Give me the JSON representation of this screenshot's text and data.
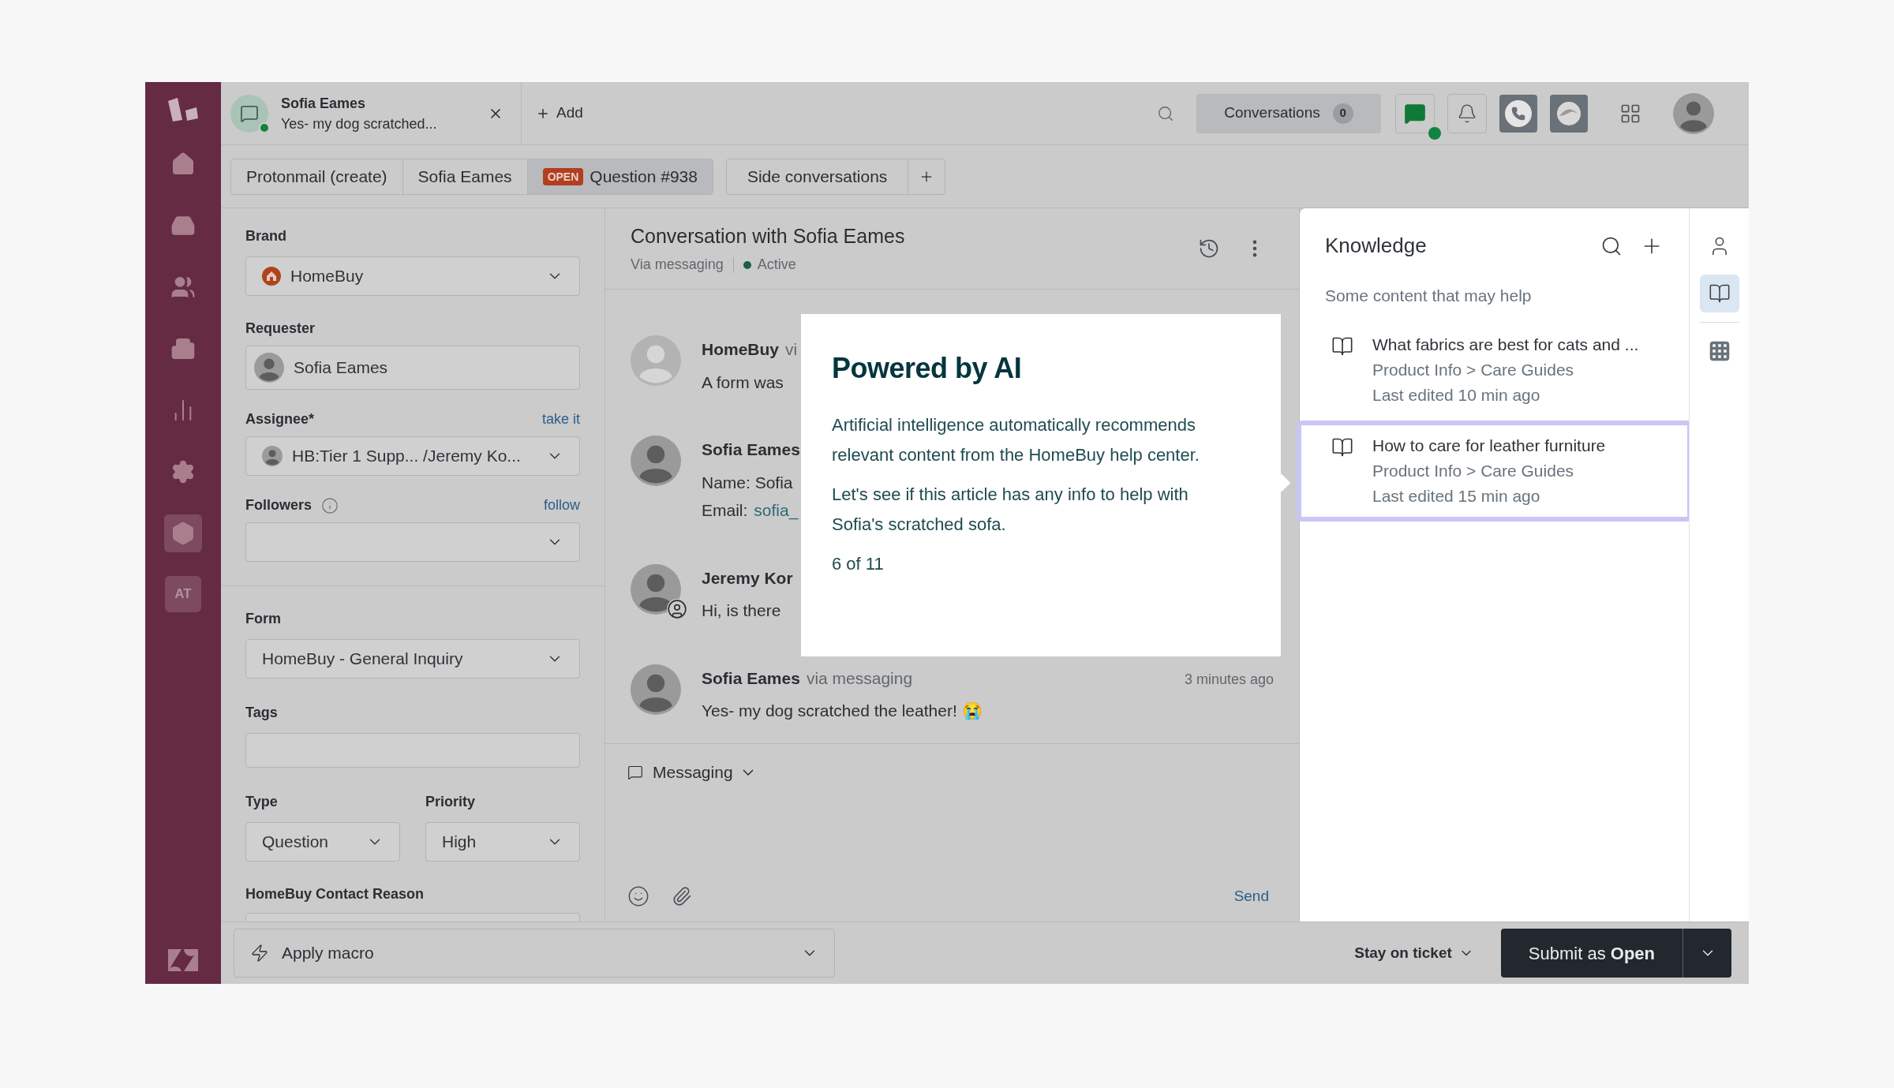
{
  "nav": {
    "items": [
      {
        "kind": "home",
        "selected": false
      },
      {
        "kind": "views",
        "selected": false
      },
      {
        "kind": "customers",
        "selected": false
      },
      {
        "kind": "organizations",
        "selected": false
      },
      {
        "kind": "reporting",
        "selected": false
      },
      {
        "kind": "admin",
        "selected": false
      },
      {
        "kind": "apps",
        "selected": true
      },
      {
        "kind": "initials",
        "label": "AT",
        "selected": false
      }
    ]
  },
  "ticket_tab": {
    "title": "Sofia Eames",
    "preview": "Yes- my dog scratched...",
    "online": true
  },
  "add_tab": {
    "label": "Add"
  },
  "conversations": {
    "label": "Conversations",
    "count": "0"
  },
  "chat_status": {
    "online": true
  },
  "subtabs": [
    {
      "label": "Protonmail (create)",
      "selected": false
    },
    {
      "label": "Sofia Eames",
      "selected": false
    },
    {
      "label": "Question #938",
      "badge": "OPEN",
      "selected": true
    }
  ],
  "side_conversations": {
    "label": "Side conversations"
  },
  "fields": {
    "brand": {
      "label": "Brand",
      "value": "HomeBuy"
    },
    "requester": {
      "label": "Requester",
      "value": "Sofia Eames"
    },
    "assignee": {
      "label": "Assignee*",
      "link": "take it",
      "value": "HB:Tier 1 Supp... /Jeremy Ko..."
    },
    "followers": {
      "label": "Followers",
      "link": "follow"
    },
    "form": {
      "label": "Form",
      "value": "HomeBuy - General Inquiry"
    },
    "tags": {
      "label": "Tags"
    },
    "type": {
      "label": "Type",
      "value": "Question"
    },
    "priority": {
      "label": "Priority",
      "value": "High"
    },
    "contact_reason": {
      "label": "HomeBuy Contact Reason"
    }
  },
  "conversation": {
    "title": "Conversation with Sofia Eames",
    "channel": "Via messaging",
    "status": "Active",
    "messages": [
      {
        "kind": "bot",
        "author": "HomeBuy",
        "via": "vi",
        "body": "A form was"
      },
      {
        "kind": "customer",
        "author": "Sofia Eames",
        "body": "Name: Sofia",
        "email_label": "Email:",
        "email": "sofia_"
      },
      {
        "kind": "agent",
        "author": "Jeremy Kor",
        "body": "Hi, is there"
      },
      {
        "kind": "customer",
        "author": "Sofia Eames",
        "via": "via messaging",
        "time": "3 minutes ago",
        "body": "Yes- my dog scratched the leather! 😭"
      }
    ]
  },
  "composer": {
    "channel": "Messaging",
    "send": "Send"
  },
  "tour": {
    "title": "Powered by AI",
    "paragraphs": [
      "Artificial intelligence automatically recommends relevant content from the HomeBuy help center.",
      "Let's see if this article has any info to help with Sofia's scratched sofa."
    ],
    "step": "6 of 11"
  },
  "knowledge": {
    "title": "Knowledge",
    "subtitle": "Some content that may help",
    "articles": [
      {
        "title": "What fabrics are best for cats and ...",
        "path": "Product Info > Care Guides",
        "edited": "Last edited 10 min ago",
        "selected": false
      },
      {
        "title": "How to care for leather furniture",
        "path": "Product Info > Care Guides",
        "edited": "Last edited 15 min ago",
        "selected": true
      }
    ]
  },
  "rail": {
    "items": [
      {
        "kind": "profile",
        "selected": false
      },
      {
        "kind": "knowledge",
        "selected": true
      },
      {
        "kind": "apps",
        "selected": false
      }
    ]
  },
  "bottom": {
    "macro": "Apply macro",
    "stay": "Stay on ticket",
    "submit": "Submit as **Open**"
  }
}
